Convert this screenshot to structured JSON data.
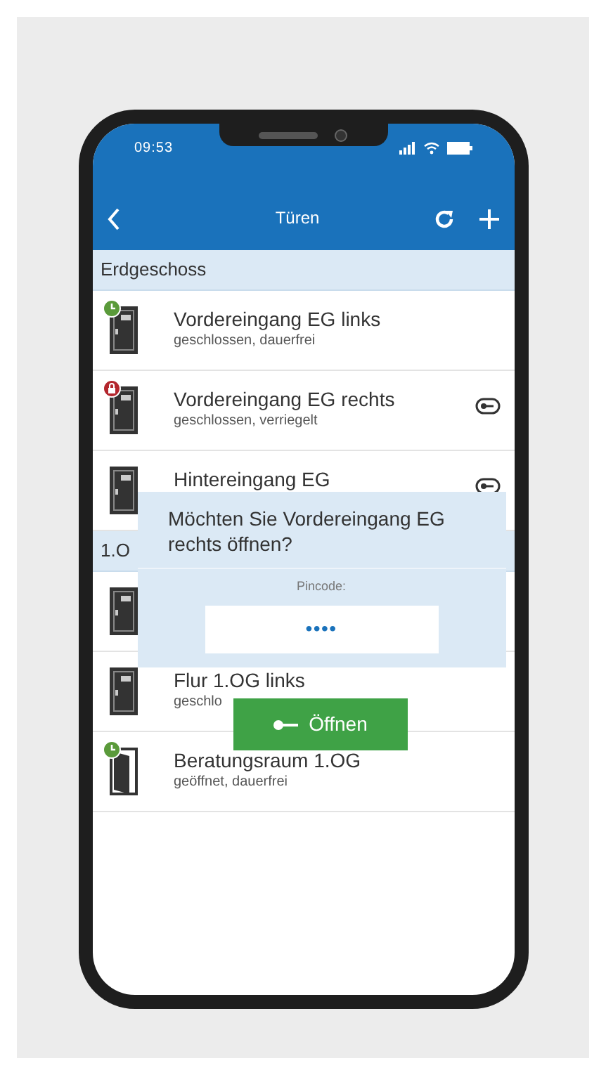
{
  "status_bar": {
    "time": "09:53"
  },
  "header": {
    "title": "Türen"
  },
  "sections": [
    {
      "title": "Erdgeschoss",
      "doors": [
        {
          "open": false,
          "timer": true,
          "locked": false,
          "name": "Vordereingang EG links",
          "status": "geschlossen, dauerfrei",
          "key": false
        },
        {
          "open": false,
          "timer": false,
          "locked": true,
          "name": "Vordereingang EG rechts",
          "status": "geschlossen, verriegelt",
          "key": true
        },
        {
          "open": false,
          "timer": false,
          "locked": false,
          "name": "Hintereingang EG",
          "key": true
        }
      ]
    },
    {
      "title": "1.O",
      "doors": [
        {
          "open": false,
          "timer": false,
          "locked": false,
          "key": false
        },
        {
          "open": false,
          "timer": false,
          "locked": false,
          "name": "Flur 1.OG links",
          "status": "geschlo",
          "key": false
        },
        {
          "open": true,
          "timer": true,
          "locked": false,
          "name": "Beratungsraum 1.OG",
          "status": "geöffnet, dauerfrei",
          "key": false
        }
      ]
    }
  ],
  "dialog": {
    "message": "Möchten Sie Vordereingang EG rechts öffnen?",
    "pin_label": "Pincode:",
    "pin_value": "••••",
    "button": "Öffnen"
  }
}
